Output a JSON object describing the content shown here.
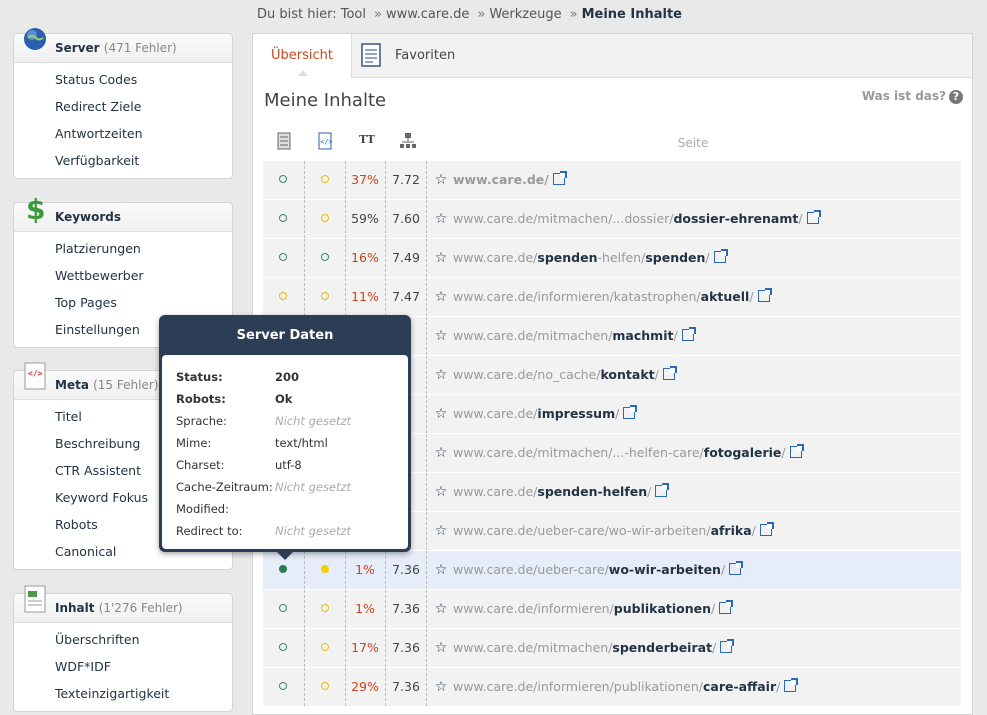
{
  "breadcrumb": {
    "items": [
      "Du bist hier: Tool",
      "www.care.de",
      "Werkzeuge"
    ],
    "current": "Meine Inhalte"
  },
  "sidebar": {
    "server": {
      "title": "Server",
      "count": "(471 Fehler)",
      "items": [
        "Status Codes",
        "Redirect Ziele",
        "Antwortzeiten",
        "Verfügbarkeit"
      ]
    },
    "keywords": {
      "title": "Keywords",
      "items": [
        "Platzierungen",
        "Wettbewerber",
        "Top Pages",
        "Einstellungen"
      ]
    },
    "meta": {
      "title": "Meta",
      "count": "(15 Fehler)",
      "items": [
        "Titel",
        "Beschreibung",
        "CTR Assistent",
        "Keyword Fokus",
        "Robots",
        "Canonical"
      ]
    },
    "inhalt": {
      "title": "Inhalt",
      "count": "(1'276 Fehler)",
      "items": [
        "Überschriften",
        "WDF*IDF",
        "Texteinzigartigkeit"
      ]
    }
  },
  "tabs": {
    "overview": "Übersicht",
    "favorites": "Favoriten"
  },
  "main": {
    "title": "Meine Inhalte",
    "help": "Was ist das?",
    "col_tt": "TT",
    "col_seite": "Seite"
  },
  "rows": [
    {
      "d1": "g",
      "d2": "y",
      "pct": "37%",
      "pct_color": "or",
      "score": "7.72",
      "url_plain": "",
      "url_parts": [],
      "domain_only": "www.care.de/"
    },
    {
      "d1": "g",
      "d2": "y",
      "pct": "59%",
      "pct_color": "gr",
      "score": "7.60",
      "url_plain": "www.care.de/mitmachen/...dossier/",
      "bold": "dossier-ehrenamt",
      "tail": "/"
    },
    {
      "d1": "g",
      "d2": "g",
      "pct": "16%",
      "pct_color": "or",
      "score": "7.49",
      "url_plain": "www.care.de/",
      "bold": "spenden",
      "mid": "-helfen/",
      "bold2": "spenden",
      "tail": "/"
    },
    {
      "d1": "y",
      "d2": "y",
      "pct": "11%",
      "pct_color": "or",
      "score": "7.47",
      "url_plain": "www.care.de/informieren/katastrophen/",
      "bold": "aktuell",
      "tail": "/"
    },
    {
      "d1": "",
      "d2": "",
      "pct": "",
      "pct_color": "gr",
      "score": "7",
      "url_plain": "www.care.de/mitmachen/",
      "bold": "machmit",
      "tail": "/"
    },
    {
      "d1": "",
      "d2": "",
      "pct": "",
      "pct_color": "gr",
      "score": "7",
      "url_plain": "www.care.de/no_cache/",
      "bold": "kontakt",
      "tail": "/"
    },
    {
      "d1": "",
      "d2": "",
      "pct": "",
      "pct_color": "gr",
      "score": "7",
      "url_plain": "www.care.de/",
      "bold": "impressum",
      "tail": "/"
    },
    {
      "d1": "",
      "d2": "",
      "pct": "",
      "pct_color": "gr",
      "score": "7",
      "url_plain": "www.care.de/mitmachen/...-helfen-care/",
      "bold": "fotogalerie",
      "tail": "/"
    },
    {
      "d1": "",
      "d2": "",
      "pct": "",
      "pct_color": "gr",
      "score": "9",
      "url_plain": "www.care.de/",
      "bold": "spenden-helfen",
      "tail": "/"
    },
    {
      "d1": "",
      "d2": "",
      "pct": "",
      "pct_color": "gr",
      "score": "5",
      "url_plain": "www.care.de/ueber-care/wo-wir-arbeiten/",
      "bold": "afrika",
      "tail": "/"
    },
    {
      "d1": "gf",
      "d2": "yf",
      "pct": "1%",
      "pct_color": "or",
      "score": "7.36",
      "url_plain": "www.care.de/ueber-care/",
      "bold": "wo-wir-arbeiten",
      "tail": "/",
      "hl": true
    },
    {
      "d1": "g",
      "d2": "y",
      "pct": "1%",
      "pct_color": "or",
      "score": "7.36",
      "url_plain": "www.care.de/informieren/",
      "bold": "publikationen",
      "tail": "/"
    },
    {
      "d1": "g",
      "d2": "y",
      "pct": "17%",
      "pct_color": "or",
      "score": "7.36",
      "url_plain": "www.care.de/mitmachen/",
      "bold": "spenderbeirat",
      "tail": "/"
    },
    {
      "d1": "g",
      "d2": "y",
      "pct": "29%",
      "pct_color": "or",
      "score": "7.36",
      "url_plain": "www.care.de/informieren/publikationen/",
      "bold": "care-affair",
      "tail": "/"
    }
  ],
  "tooltip": {
    "title": "Server Daten",
    "fields": [
      {
        "k": "Status:",
        "v": "200",
        "bold": true
      },
      {
        "k": "Robots:",
        "v": "Ok",
        "bold": true
      },
      {
        "k": "Sprache:",
        "v": "Nicht gesetzt",
        "na": true
      },
      {
        "k": "Mime:",
        "v": "text/html"
      },
      {
        "k": "Charset:",
        "v": "utf-8"
      },
      {
        "k": "Cache-Zeitraum:",
        "v": "Nicht gesetzt",
        "na": true
      },
      {
        "k": "Modified:",
        "v": ""
      },
      {
        "k": "Redirect to:",
        "v": "Nicht gesetzt",
        "na": true
      }
    ]
  }
}
